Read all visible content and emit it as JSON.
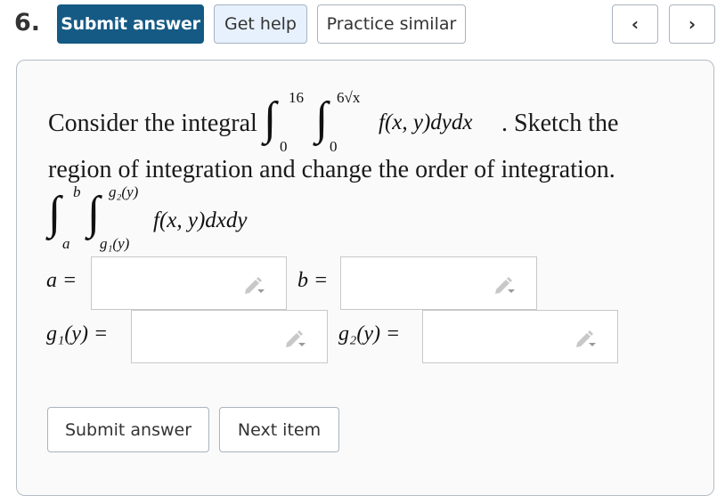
{
  "header": {
    "question_number": "6.",
    "submit_label": "Submit answer",
    "help_label": "Get help",
    "practice_label": "Practice similar",
    "prev_icon": "chevron-left-icon",
    "next_icon": "chevron-right-icon",
    "prev_glyph": "‹",
    "next_glyph": "›"
  },
  "question": {
    "intro": "Consider the integral",
    "outer_upper": "16",
    "outer_lower": "0",
    "inner_upper": "6√x",
    "inner_lower": "0",
    "integrand": "f(x, y)dydx",
    "after": ". Sketch the",
    "line2": "region of integration and change the order of integration.",
    "reversed": {
      "outer_upper": "b",
      "outer_lower": "a",
      "inner_upper": "g₂(y)",
      "inner_lower": "g₁(y)",
      "integrand": "f(x, y)dxdy"
    }
  },
  "fields": [
    {
      "label": "a =",
      "value": "",
      "icon": "pencil-dropdown-icon"
    },
    {
      "label": "b =",
      "value": "",
      "icon": "pencil-dropdown-icon"
    },
    {
      "label": "g₁(y) =",
      "value": "",
      "icon": "pencil-dropdown-icon"
    },
    {
      "label": "g₂(y) =",
      "value": "",
      "icon": "pencil-dropdown-icon"
    }
  ],
  "footer": {
    "submit_label": "Submit answer",
    "next_label": "Next item"
  }
}
